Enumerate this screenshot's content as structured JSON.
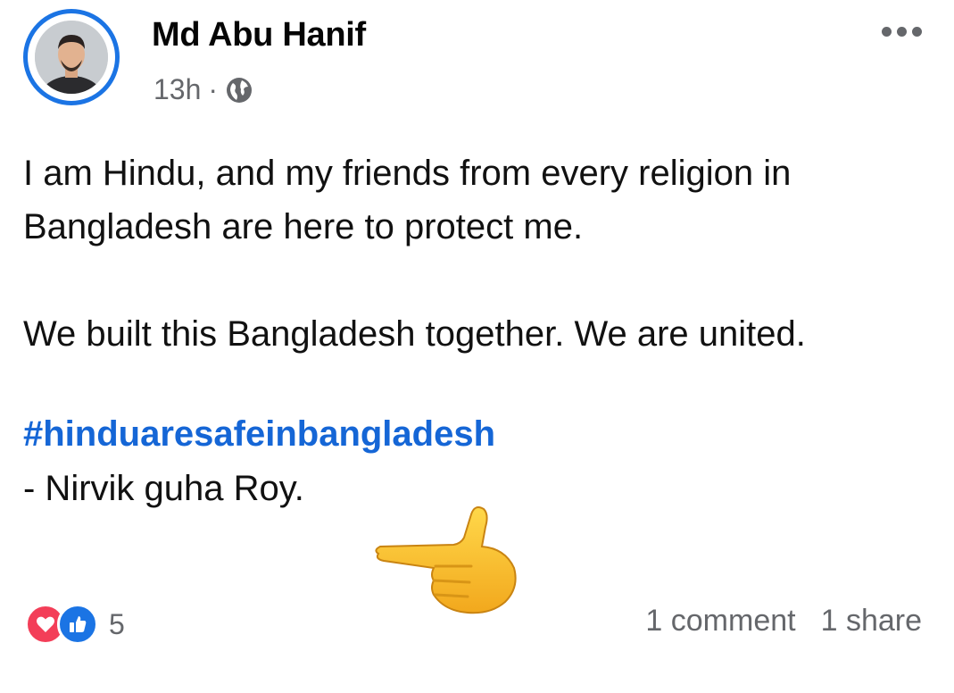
{
  "post": {
    "author_name": "Md Abu Hanif",
    "time": "13h",
    "separator": "·",
    "privacy_icon": "globe-icon",
    "more_icon": "more-horizontal-icon",
    "paragraphs": [
      "I am Hindu, and my friends from every religion in Bangladesh are here to protect me.",
      "We built this Bangladesh together. We are united."
    ],
    "hashtag": "#hinduaresafeinbangladesh",
    "signature": "- Nirvik guha Roy.",
    "pointing_emoji": "backhand-index-pointing-left-icon"
  },
  "footer": {
    "reaction_icons": [
      "love-reaction-icon",
      "like-reaction-icon"
    ],
    "reaction_count": "5",
    "comments": "1 comment",
    "shares": "1 share"
  },
  "colors": {
    "brand_blue": "#1b74e4",
    "hashtag_blue": "#1566d6",
    "love_red": "#f33e58",
    "secondary_text": "#65676b"
  }
}
